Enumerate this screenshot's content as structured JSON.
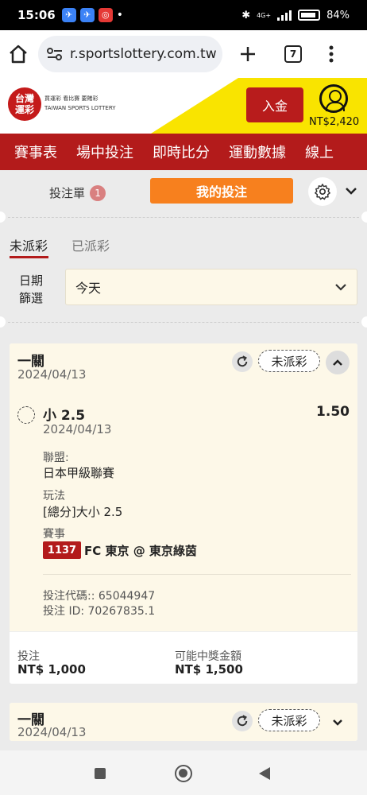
{
  "status_bar": {
    "time": "15:06",
    "network": "4G+",
    "battery": "84%"
  },
  "browser": {
    "url": "r.sportslottery.com.tw",
    "tab_count": "7"
  },
  "header": {
    "logo_line1": "台灣",
    "logo_line2": "運彩",
    "logo_taglines": "買運彩 看比賽 要賭彩",
    "logo_en": "TAIWAN SPORTS LOTTERY",
    "deposit_label": "入金",
    "balance": "NT$2,420"
  },
  "nav": {
    "items": [
      "賽事表",
      "場中投注",
      "即時比分",
      "運動數據",
      "線上"
    ]
  },
  "bet_bar": {
    "betslip_label": "投注單",
    "betslip_count": "1",
    "my_bets_label": "我的投注"
  },
  "status_tabs": {
    "unsettled": "未派彩",
    "settled": "已派彩"
  },
  "filter": {
    "label_line1": "日期",
    "label_line2": "篩選",
    "selected": "今天"
  },
  "bets": [
    {
      "type": "一關",
      "date": "2024/04/13",
      "status": "未派彩",
      "selection": "小 2.5",
      "selection_date": "2024/04/13",
      "odds": "1.50",
      "league_label": "聯盟:",
      "league": "日本甲級聯賽",
      "market_label": "玩法",
      "market": "[總分]大小 2.5",
      "event_label": "賽事",
      "match_number": "1137",
      "match": "FC 東京 @ 東京綠茵",
      "bet_code": "投注代碼:: 65044947",
      "bet_id": "投注 ID: 70267835.1",
      "stake_label": "投注",
      "stake": "NT$ 1,000",
      "payout_label": "可能中獎金額",
      "payout": "NT$ 1,500"
    },
    {
      "type": "一關",
      "date": "2024/04/13",
      "status": "未派彩"
    }
  ]
}
